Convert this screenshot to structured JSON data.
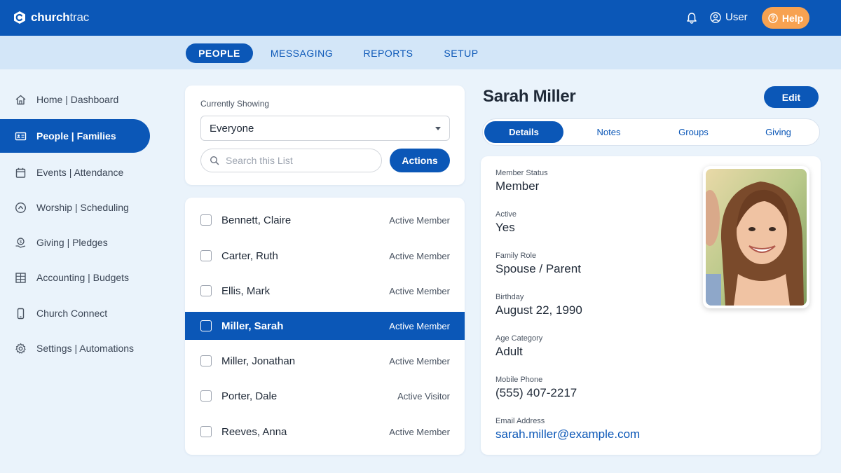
{
  "app": {
    "logo_bold": "church",
    "logo_light": "trac",
    "user_label": "User",
    "help_label": "Help"
  },
  "nav": {
    "tabs": [
      {
        "label": "PEOPLE",
        "active": true
      },
      {
        "label": "MESSAGING",
        "active": false
      },
      {
        "label": "REPORTS",
        "active": false
      },
      {
        "label": "SETUP",
        "active": false
      }
    ]
  },
  "sidebar": {
    "items": [
      {
        "label": "Home | Dashboard",
        "icon": "home-icon",
        "active": false
      },
      {
        "label": "People | Families",
        "icon": "id-card-icon",
        "active": true
      },
      {
        "label": "Events | Attendance",
        "icon": "calendar-icon",
        "active": false
      },
      {
        "label": "Worship | Scheduling",
        "icon": "worship-icon",
        "active": false
      },
      {
        "label": "Giving | Pledges",
        "icon": "giving-icon",
        "active": false
      },
      {
        "label": "Accounting | Budgets",
        "icon": "grid-icon",
        "active": false
      },
      {
        "label": "Church Connect",
        "icon": "phone-icon",
        "active": false
      },
      {
        "label": "Settings | Automations",
        "icon": "gear-icon",
        "active": false
      }
    ]
  },
  "filter": {
    "label": "Currently Showing",
    "selected": "Everyone",
    "search_placeholder": "Search this List",
    "actions_label": "Actions"
  },
  "people": [
    {
      "name": "Bennett, Claire",
      "status": "Active Member",
      "selected": false
    },
    {
      "name": "Carter, Ruth",
      "status": "Active Member",
      "selected": false
    },
    {
      "name": "Ellis, Mark",
      "status": "Active Member",
      "selected": false
    },
    {
      "name": "Miller, Sarah",
      "status": "Active Member",
      "selected": true
    },
    {
      "name": "Miller, Jonathan",
      "status": "Active Member",
      "selected": false
    },
    {
      "name": "Porter, Dale",
      "status": "Active Visitor",
      "selected": false
    },
    {
      "name": "Reeves, Anna",
      "status": "Active Member",
      "selected": false
    }
  ],
  "detail": {
    "name": "Sarah Miller",
    "edit_label": "Edit",
    "tabs": [
      {
        "label": "Details",
        "active": true
      },
      {
        "label": "Notes",
        "active": false
      },
      {
        "label": "Groups",
        "active": false
      },
      {
        "label": "Giving",
        "active": false
      }
    ],
    "fields": [
      {
        "label": "Member Status",
        "value": "Member"
      },
      {
        "label": "Active",
        "value": "Yes"
      },
      {
        "label": "Family Role",
        "value": "Spouse / Parent"
      },
      {
        "label": "Birthday",
        "value": "August 22, 1990"
      },
      {
        "label": "Age Category",
        "value": "Adult"
      },
      {
        "label": "Mobile Phone",
        "value": "(555) 407-2217"
      },
      {
        "label": "Email Address",
        "value": "sarah.miller@example.com"
      }
    ]
  },
  "colors": {
    "brand": "#0b57b7",
    "nav_bg": "#d3e6f8",
    "page_bg": "#eaf3fb",
    "help": "#f7a251"
  }
}
